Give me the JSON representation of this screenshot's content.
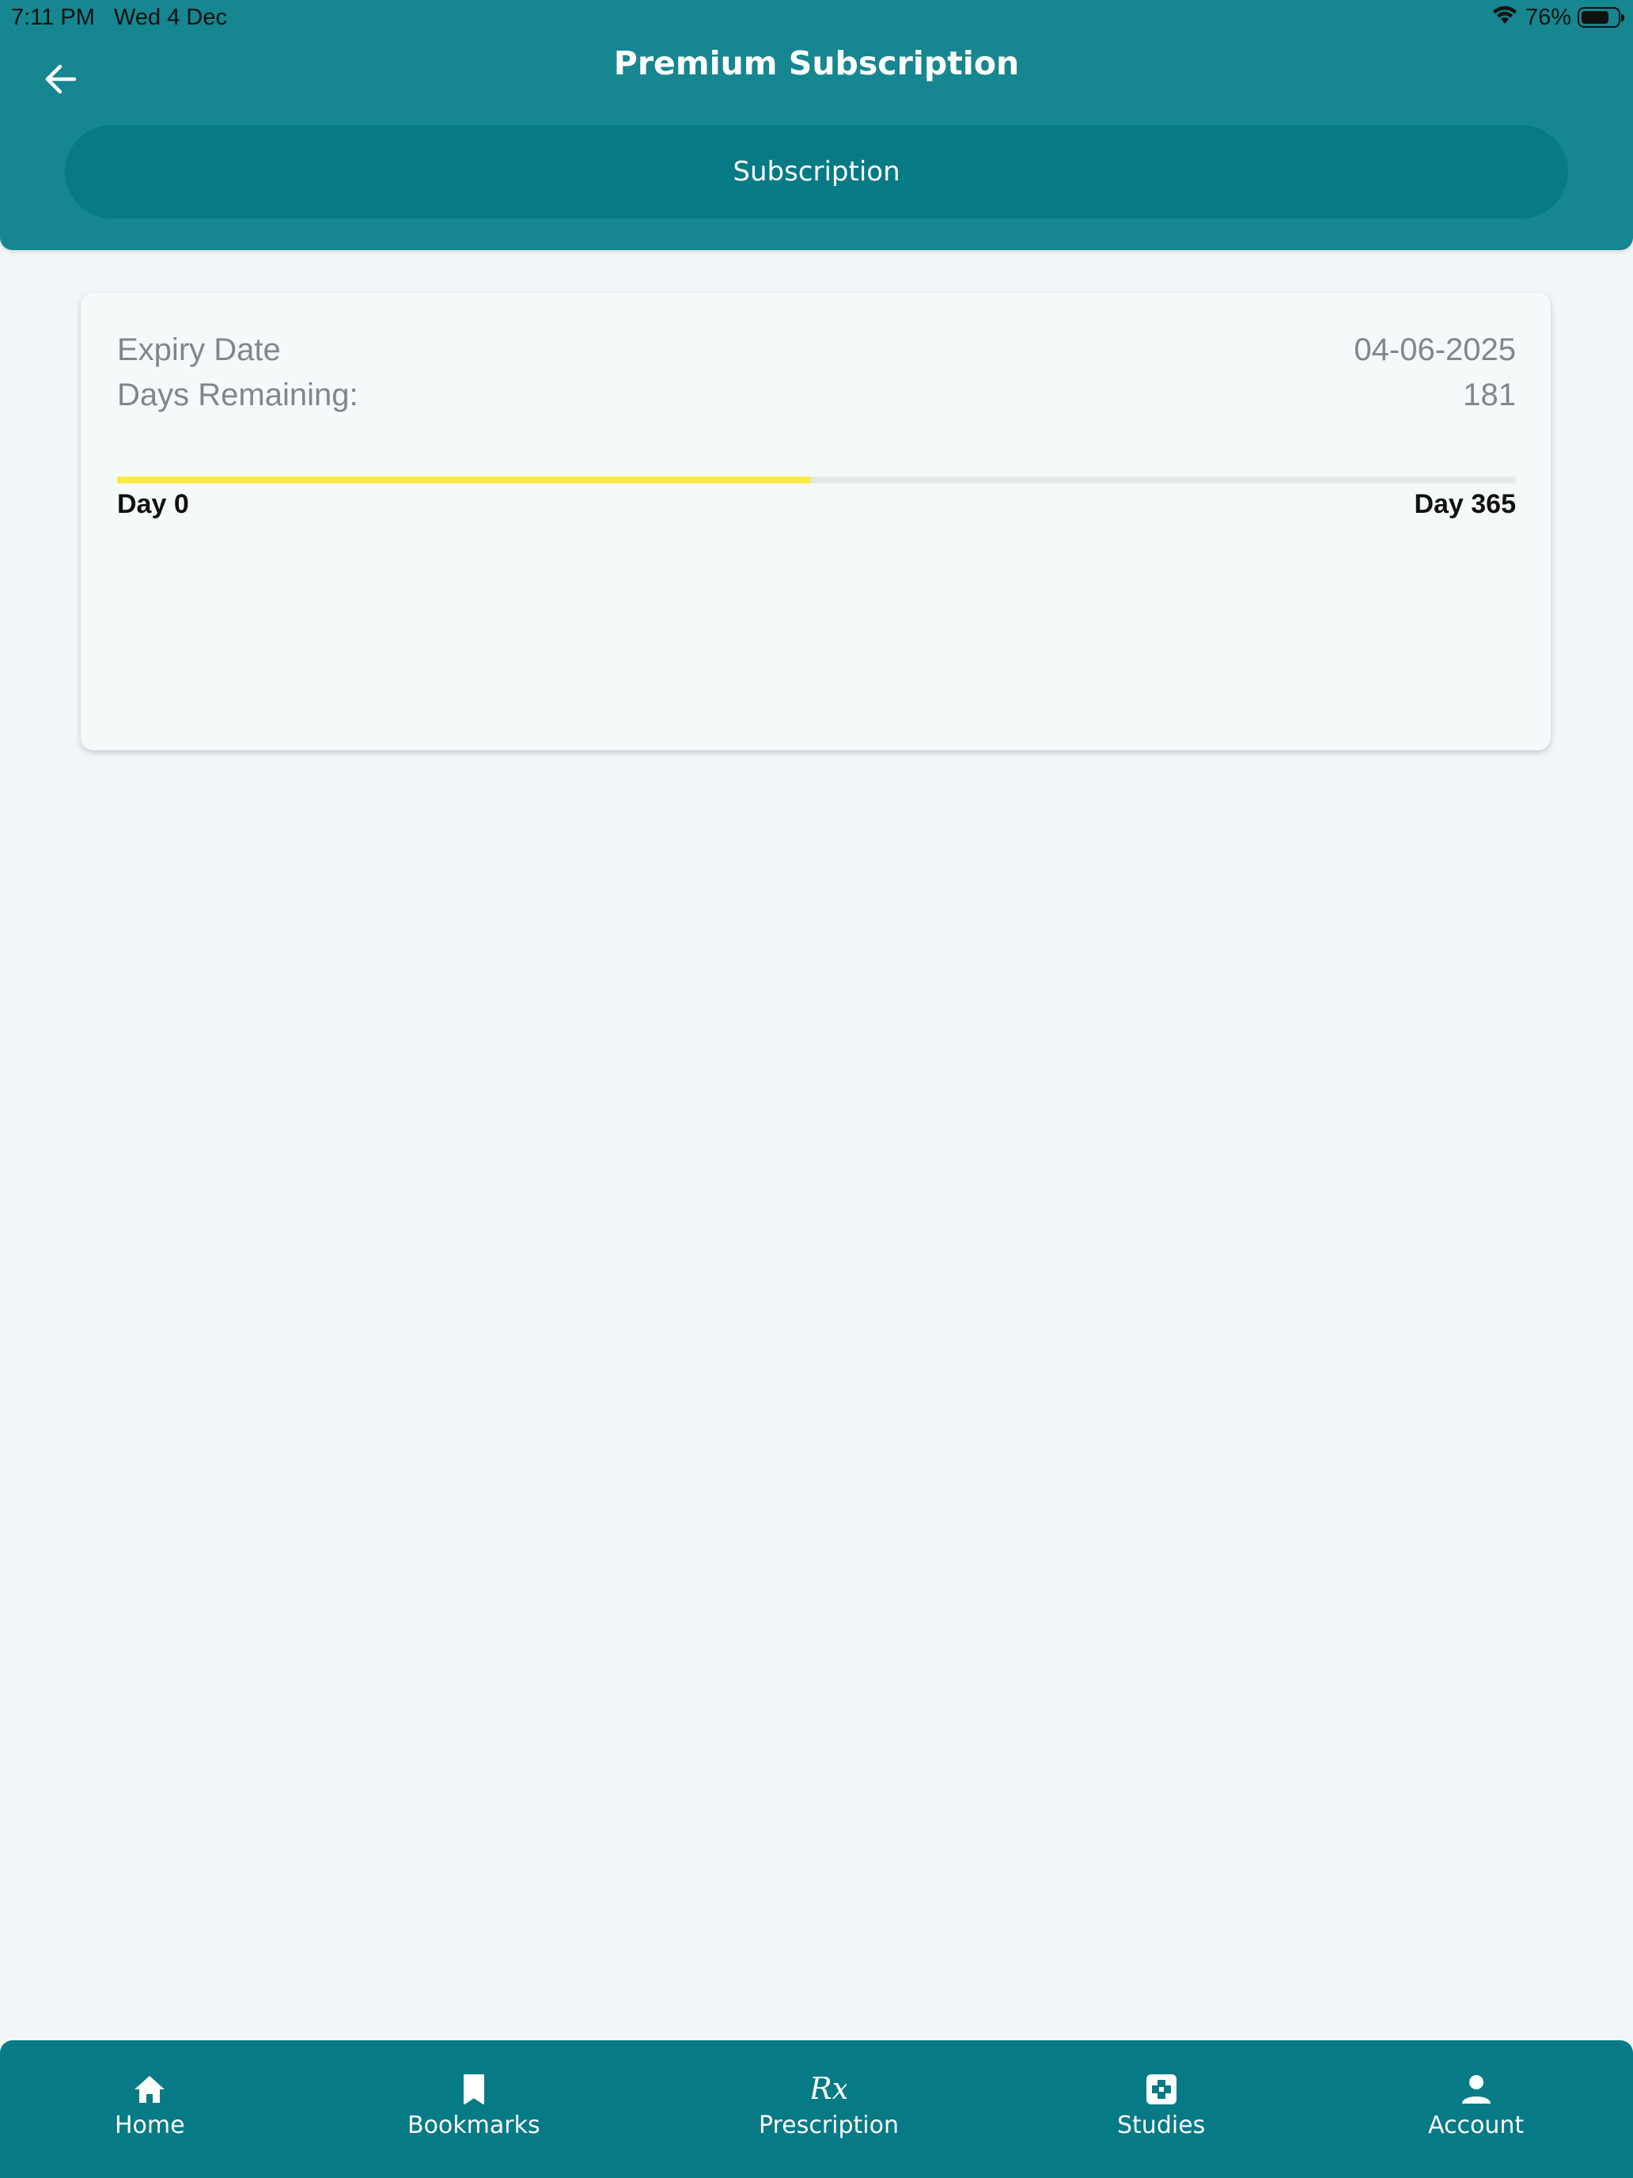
{
  "status_bar": {
    "time": "7:11 PM",
    "date": "Wed 4 Dec",
    "battery": "76%",
    "battery_level": 0.76,
    "wifi_icon": "wifi-icon",
    "battery_icon": "battery-icon"
  },
  "header": {
    "title": "Premium Subscription",
    "back_icon": "arrow-left-icon",
    "tab_label": "Subscription",
    "color": "#168690"
  },
  "subscription": {
    "expiry_label": "Expiry Date",
    "expiry_value": "04-06-2025",
    "days_label": "Days Remaining:",
    "days_value": "181",
    "progress_fraction": 0.496,
    "progress_color": "#fbe84a",
    "start_label": "Day 0",
    "end_label": "Day 365"
  },
  "bottom_nav": {
    "color": "#067b86",
    "items": [
      {
        "label": "Home",
        "icon": "home-icon"
      },
      {
        "label": "Bookmarks",
        "icon": "bookmark-icon"
      },
      {
        "label": "Prescription",
        "icon": "rx-icon"
      },
      {
        "label": "Studies",
        "icon": "medical-cross-icon"
      },
      {
        "label": "Account",
        "icon": "person-icon"
      }
    ]
  }
}
